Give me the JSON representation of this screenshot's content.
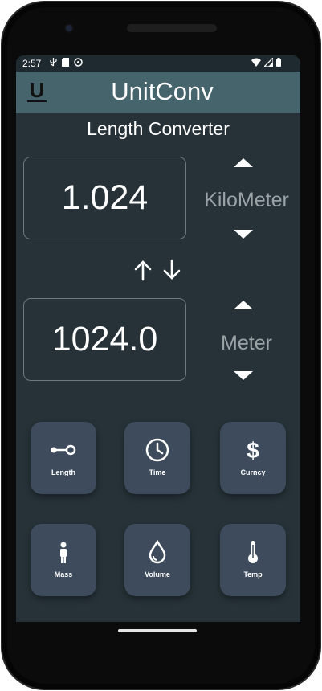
{
  "status_bar": {
    "time": "2:57"
  },
  "app_bar": {
    "logo_letter": "U",
    "title": "UnitConv"
  },
  "converter": {
    "title": "Length Converter",
    "from": {
      "value": "1.024",
      "unit": "KiloMeter"
    },
    "to": {
      "value": "1024.0",
      "unit": "Meter"
    }
  },
  "categories": [
    {
      "label": "Length",
      "icon": "length-icon"
    },
    {
      "label": "Time",
      "icon": "clock-icon"
    },
    {
      "label": "Curncy",
      "icon": "dollar-icon"
    },
    {
      "label": "Mass",
      "icon": "person-icon"
    },
    {
      "label": "Volume",
      "icon": "drop-icon"
    },
    {
      "label": "Temp",
      "icon": "thermometer-icon"
    }
  ],
  "colors": {
    "screen_bg": "#263238",
    "app_bar": "#46646b",
    "button_bg": "#3d4b5c",
    "unit_text": "#9aa3a6"
  }
}
